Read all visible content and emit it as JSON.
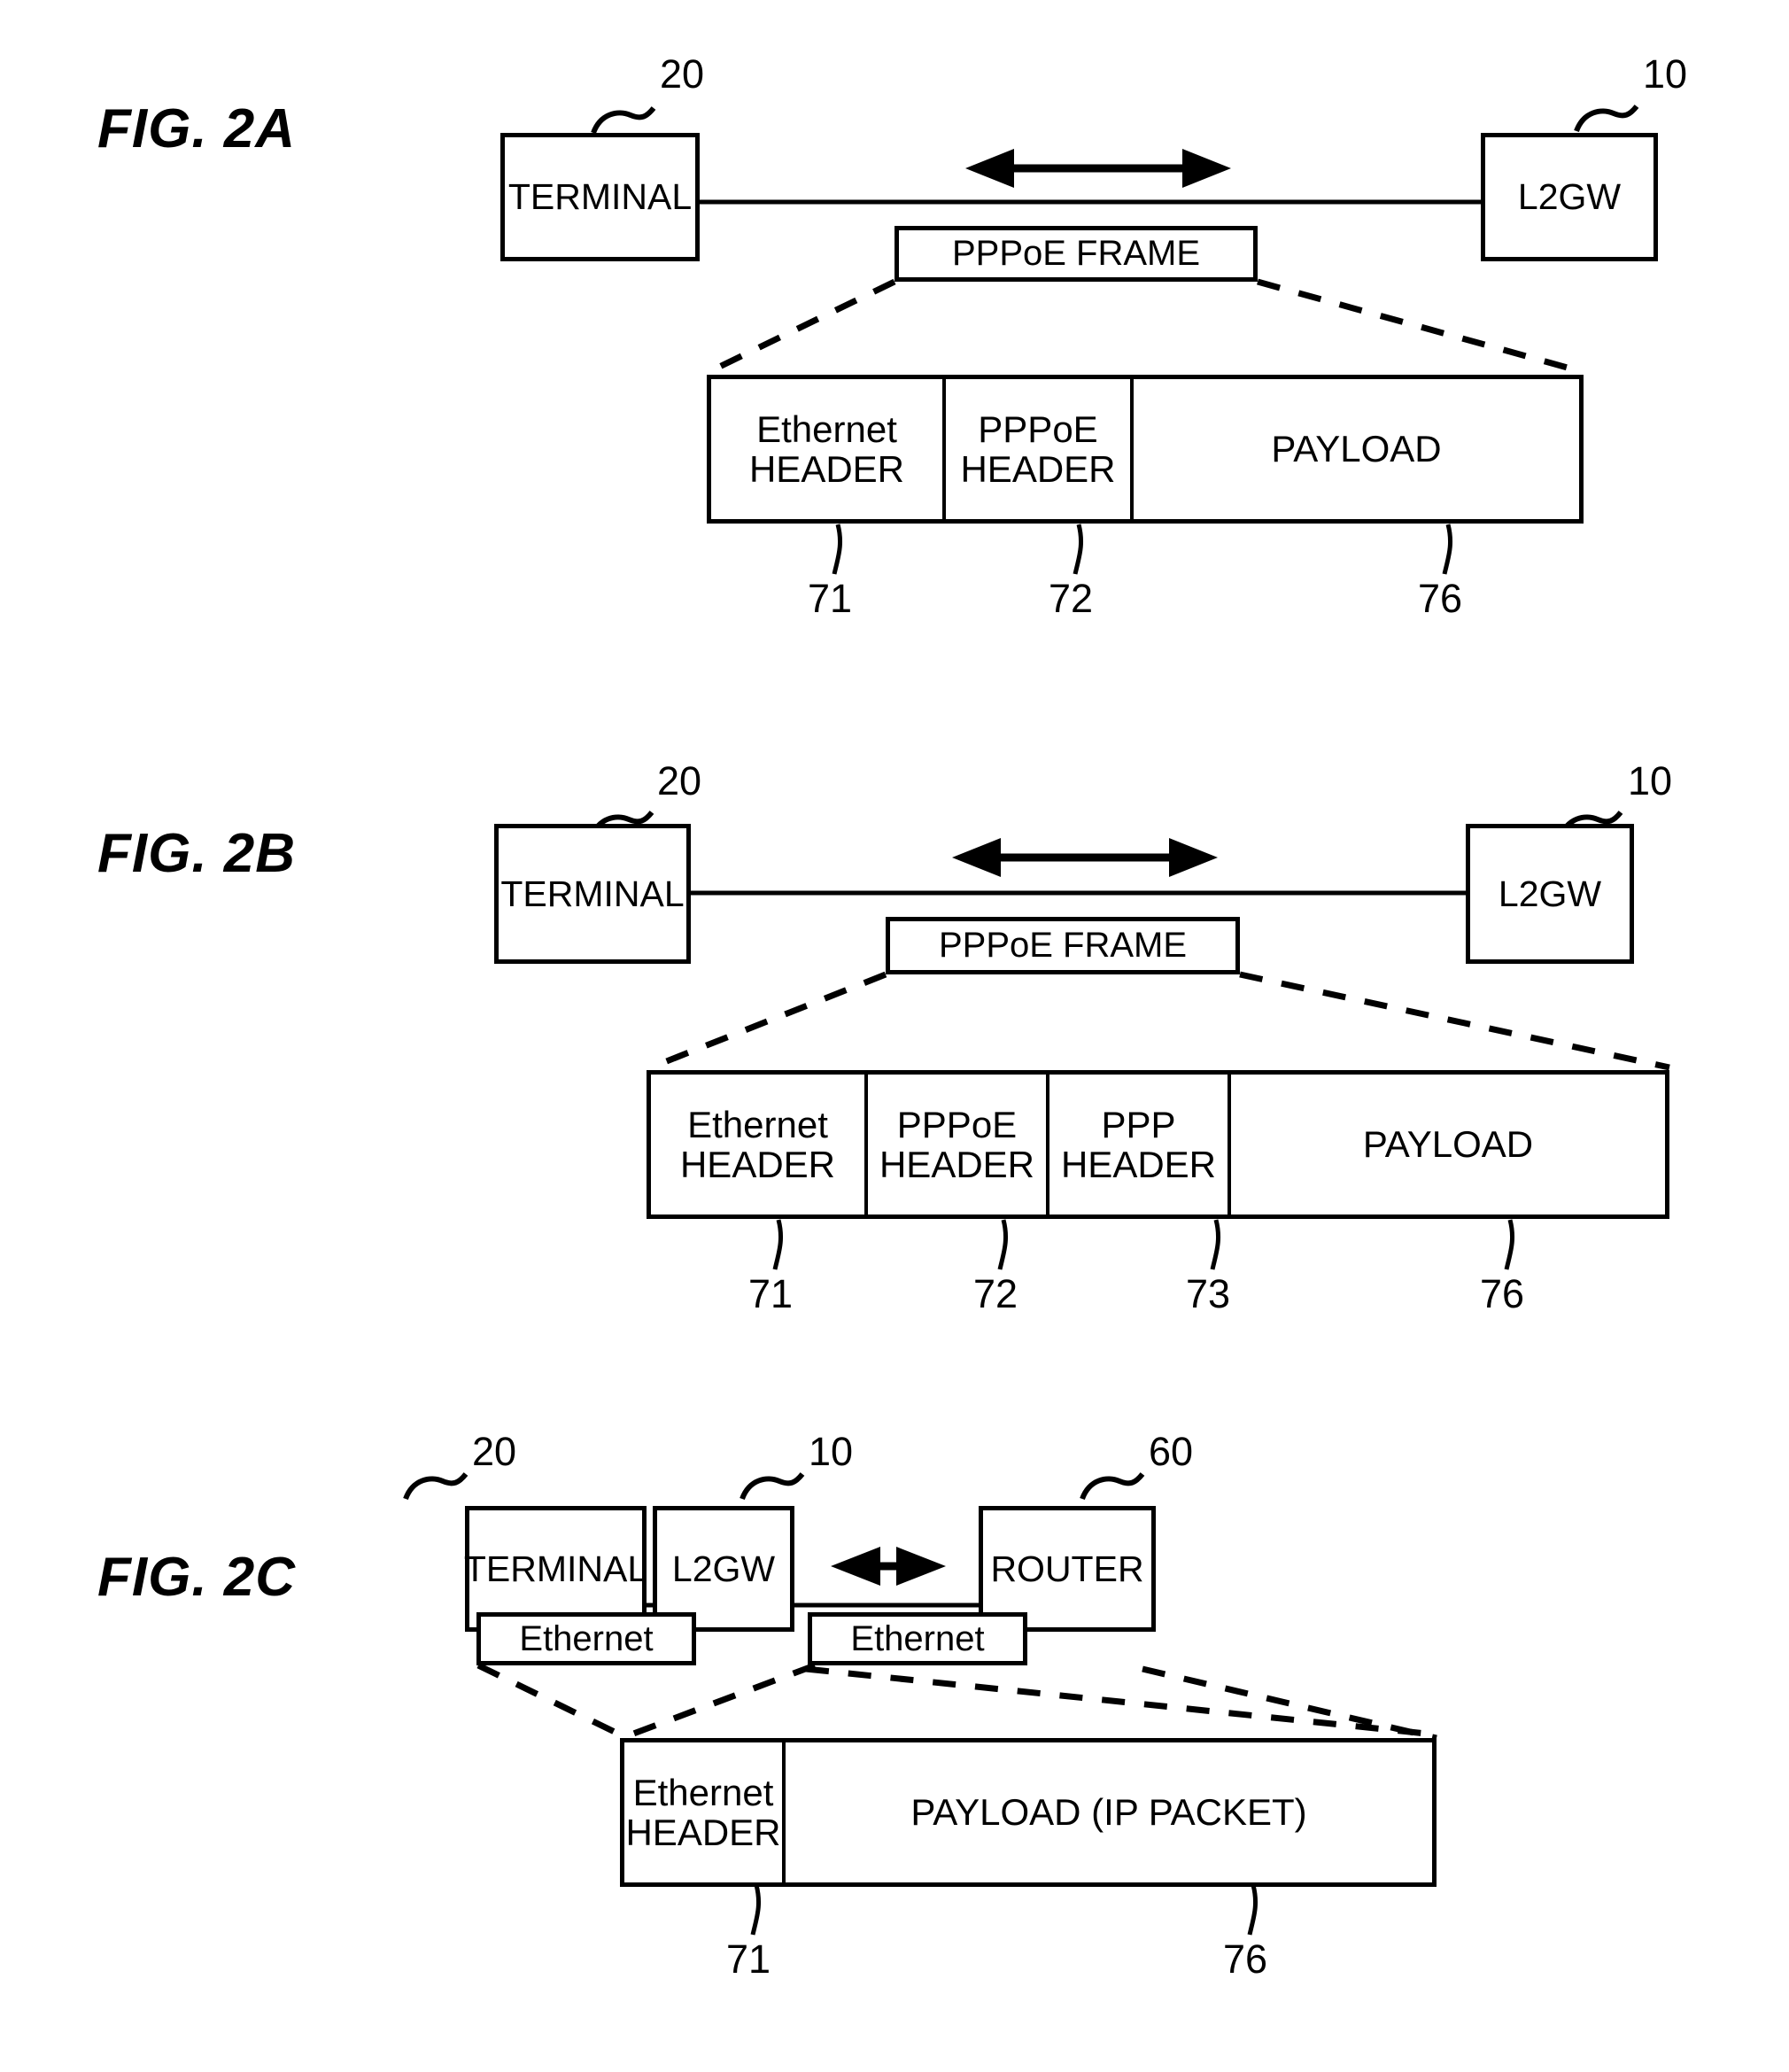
{
  "document": {
    "type": "patent-figure-sheet",
    "figures": [
      {
        "id": "fig2a",
        "label": "FIG. 2A",
        "network": {
          "left_node": {
            "label": "TERMINAL",
            "ref": "20"
          },
          "right_node": {
            "label": "L2GW",
            "ref": "10"
          },
          "link_label": "PPPoE FRAME",
          "arrow": "bidirectional"
        },
        "frame": {
          "cells": [
            {
              "line1": "Ethernet",
              "line2": "HEADER",
              "ref": "71"
            },
            {
              "line1": "PPPoE",
              "line2": "HEADER",
              "ref": "72"
            },
            {
              "line1": "PAYLOAD",
              "line2": "",
              "ref": "76"
            }
          ]
        }
      },
      {
        "id": "fig2b",
        "label": "FIG. 2B",
        "network": {
          "left_node": {
            "label": "TERMINAL",
            "ref": "20"
          },
          "right_node": {
            "label": "L2GW",
            "ref": "10"
          },
          "link_label": "PPPoE FRAME",
          "arrow": "bidirectional"
        },
        "frame": {
          "cells": [
            {
              "line1": "Ethernet",
              "line2": "HEADER",
              "ref": "71"
            },
            {
              "line1": "PPPoE",
              "line2": "HEADER",
              "ref": "72"
            },
            {
              "line1": "PPP",
              "line2": "HEADER",
              "ref": "73"
            },
            {
              "line1": "PAYLOAD",
              "line2": "",
              "ref": "76"
            }
          ]
        }
      },
      {
        "id": "fig2c",
        "label": "FIG. 2C",
        "network": {
          "left_node": {
            "label": "TERMINAL",
            "ref": "20"
          },
          "middle_node": {
            "label": "L2GW",
            "ref": "10"
          },
          "right_node": {
            "label": "ROUTER",
            "ref": "60"
          },
          "link_label_left": "Ethernet",
          "link_label_right": "Ethernet",
          "arrow": "bidirectional"
        },
        "frame": {
          "cells": [
            {
              "line1": "Ethernet",
              "line2": "HEADER",
              "ref": "71"
            },
            {
              "line1": "PAYLOAD (IP PACKET)",
              "line2": "",
              "ref": "76"
            }
          ]
        }
      }
    ]
  },
  "style": {
    "ink": "#000000",
    "paper": "#ffffff"
  }
}
